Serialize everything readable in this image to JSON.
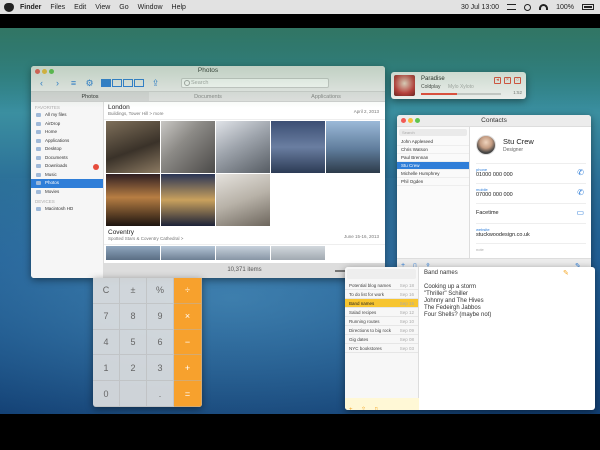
{
  "menubar": {
    "items": [
      "Finder",
      "Files",
      "Edit",
      "View",
      "Go",
      "Window",
      "Help"
    ],
    "datetime": "30 Jul 13:00",
    "battery": "100%"
  },
  "photos": {
    "title": "Photos",
    "search_placeholder": "Search",
    "tabs": [
      "Photos",
      "Documents",
      "Applications"
    ],
    "sidebar_head1": "FAVORITES",
    "sidebar_items": [
      "All my files",
      "AirDrop",
      "Home",
      "Applications",
      "Desktop",
      "Documents",
      "Downloads",
      "Music",
      "Photos",
      "Movies"
    ],
    "sidebar_head2": "DEVICES",
    "sidebar_device": "Macintosh HD",
    "group1": {
      "title": "London",
      "subtitle": "Buildings, Tower Hill > more",
      "date": "April 2, 2013"
    },
    "group2": {
      "title": "Coventry",
      "subtitle": "Spotted Stars & Coventry Cathedral >",
      "date": "June 15-16, 2013"
    },
    "status": "10,371 items"
  },
  "calculator": {
    "keys": [
      "C",
      "±",
      "%",
      "÷",
      "7",
      "8",
      "9",
      "×",
      "4",
      "5",
      "6",
      "−",
      "1",
      "2",
      "3",
      "+",
      "0",
      "",
      ".",
      "="
    ]
  },
  "music": {
    "title": "Paradise",
    "artist": "Coldplay",
    "album": "Mylo Xyloto",
    "time": "1:52"
  },
  "contacts": {
    "title": "Contacts",
    "search_placeholder": "Search",
    "list": [
      "John Appleseed",
      "Chris Watson",
      "Paul Brennan",
      "Stu Crew",
      "Michelle Humphrey",
      "Phil Ogden"
    ],
    "selected_index": 3,
    "name": "Stu Crew",
    "role": "Designer",
    "phone_label": "phone",
    "phone": "01000 000 000",
    "mobile_label": "mobile",
    "mobile": "07000 000 000",
    "facetime_label": "Facetime",
    "website_label": "website",
    "website": "stuckwoodesign.co.uk",
    "note_label": "note"
  },
  "notes": {
    "items": [
      {
        "title": "Potential blog names",
        "date": "Sep 18"
      },
      {
        "title": "To do list for work",
        "date": "Sep 16"
      },
      {
        "title": "Band names",
        "date": "Sep 15"
      },
      {
        "title": "Salad recipes",
        "date": "Sep 12"
      },
      {
        "title": "Running routes",
        "date": "Sep 10"
      },
      {
        "title": "Directions to big rock",
        "date": "Sep 09"
      },
      {
        "title": "Gig dates",
        "date": "Sep 08"
      },
      {
        "title": "NYC bookstores",
        "date": "Sep 03"
      }
    ],
    "selected_index": 2,
    "body_title": "Band names",
    "body_lines": [
      "Cooking up a storm",
      "\"Thriller\" Schiller",
      "Johnny and The Hives",
      "The Fedeirgh Jabbos",
      "Four Shells? (maybe not)"
    ]
  },
  "colors": {
    "accent": "#2f7ed8",
    "notes_yellow": "#f7c530",
    "calc_orange": "#f7a12d"
  }
}
